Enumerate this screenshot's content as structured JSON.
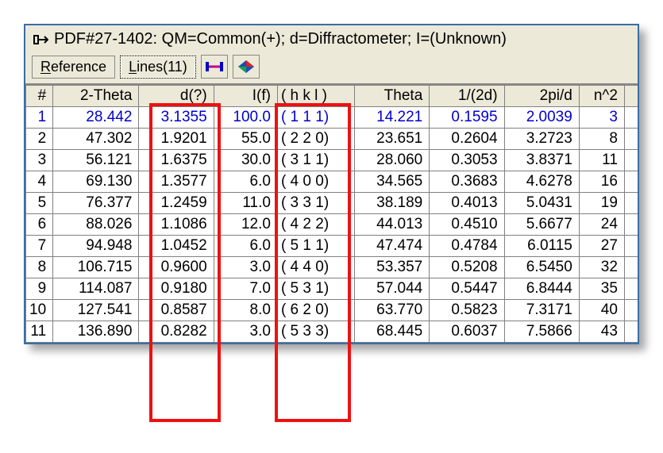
{
  "title": "PDF#27-1402: QM=Common(+); d=Diffractometer; I=(Unknown)",
  "toolbar": {
    "reference_label": "Reference",
    "lines_label": "Lines(11)"
  },
  "columns": {
    "idx": "#",
    "twotheta": "2-Theta",
    "d": "d(?)",
    "if": "I(f)",
    "hkl": "( h k l )",
    "theta": "Theta",
    "inv2d": "1/(2d)",
    "twopid": "2pi/d",
    "n2": "n^2"
  },
  "rows": [
    {
      "idx": "1",
      "twotheta": "28.442",
      "d": "3.1355",
      "if": "100.0",
      "hkl": "( 1 1 1)",
      "theta": "14.221",
      "inv2d": "0.1595",
      "twopid": "2.0039",
      "n2": "3"
    },
    {
      "idx": "2",
      "twotheta": "47.302",
      "d": "1.9201",
      "if": "55.0",
      "hkl": "( 2 2 0)",
      "theta": "23.651",
      "inv2d": "0.2604",
      "twopid": "3.2723",
      "n2": "8"
    },
    {
      "idx": "3",
      "twotheta": "56.121",
      "d": "1.6375",
      "if": "30.0",
      "hkl": "( 3 1 1)",
      "theta": "28.060",
      "inv2d": "0.3053",
      "twopid": "3.8371",
      "n2": "11"
    },
    {
      "idx": "4",
      "twotheta": "69.130",
      "d": "1.3577",
      "if": "6.0",
      "hkl": "( 4 0 0)",
      "theta": "34.565",
      "inv2d": "0.3683",
      "twopid": "4.6278",
      "n2": "16"
    },
    {
      "idx": "5",
      "twotheta": "76.377",
      "d": "1.2459",
      "if": "11.0",
      "hkl": "( 3 3 1)",
      "theta": "38.189",
      "inv2d": "0.4013",
      "twopid": "5.0431",
      "n2": "19"
    },
    {
      "idx": "6",
      "twotheta": "88.026",
      "d": "1.1086",
      "if": "12.0",
      "hkl": "( 4 2 2)",
      "theta": "44.013",
      "inv2d": "0.4510",
      "twopid": "5.6677",
      "n2": "24"
    },
    {
      "idx": "7",
      "twotheta": "94.948",
      "d": "1.0452",
      "if": "6.0",
      "hkl": "( 5 1 1)",
      "theta": "47.474",
      "inv2d": "0.4784",
      "twopid": "6.0115",
      "n2": "27"
    },
    {
      "idx": "8",
      "twotheta": "106.715",
      "d": "0.9600",
      "if": "3.0",
      "hkl": "( 4 4 0)",
      "theta": "53.357",
      "inv2d": "0.5208",
      "twopid": "6.5450",
      "n2": "32"
    },
    {
      "idx": "9",
      "twotheta": "114.087",
      "d": "0.9180",
      "if": "7.0",
      "hkl": "( 5 3 1)",
      "theta": "57.044",
      "inv2d": "0.5447",
      "twopid": "6.8444",
      "n2": "35"
    },
    {
      "idx": "10",
      "twotheta": "127.541",
      "d": "0.8587",
      "if": "8.0",
      "hkl": "( 6 2 0)",
      "theta": "63.770",
      "inv2d": "0.5823",
      "twopid": "7.3171",
      "n2": "40"
    },
    {
      "idx": "11",
      "twotheta": "136.890",
      "d": "0.8282",
      "if": "3.0",
      "hkl": "( 5 3 3)",
      "theta": "68.445",
      "inv2d": "0.6037",
      "twopid": "7.5866",
      "n2": "43"
    }
  ]
}
